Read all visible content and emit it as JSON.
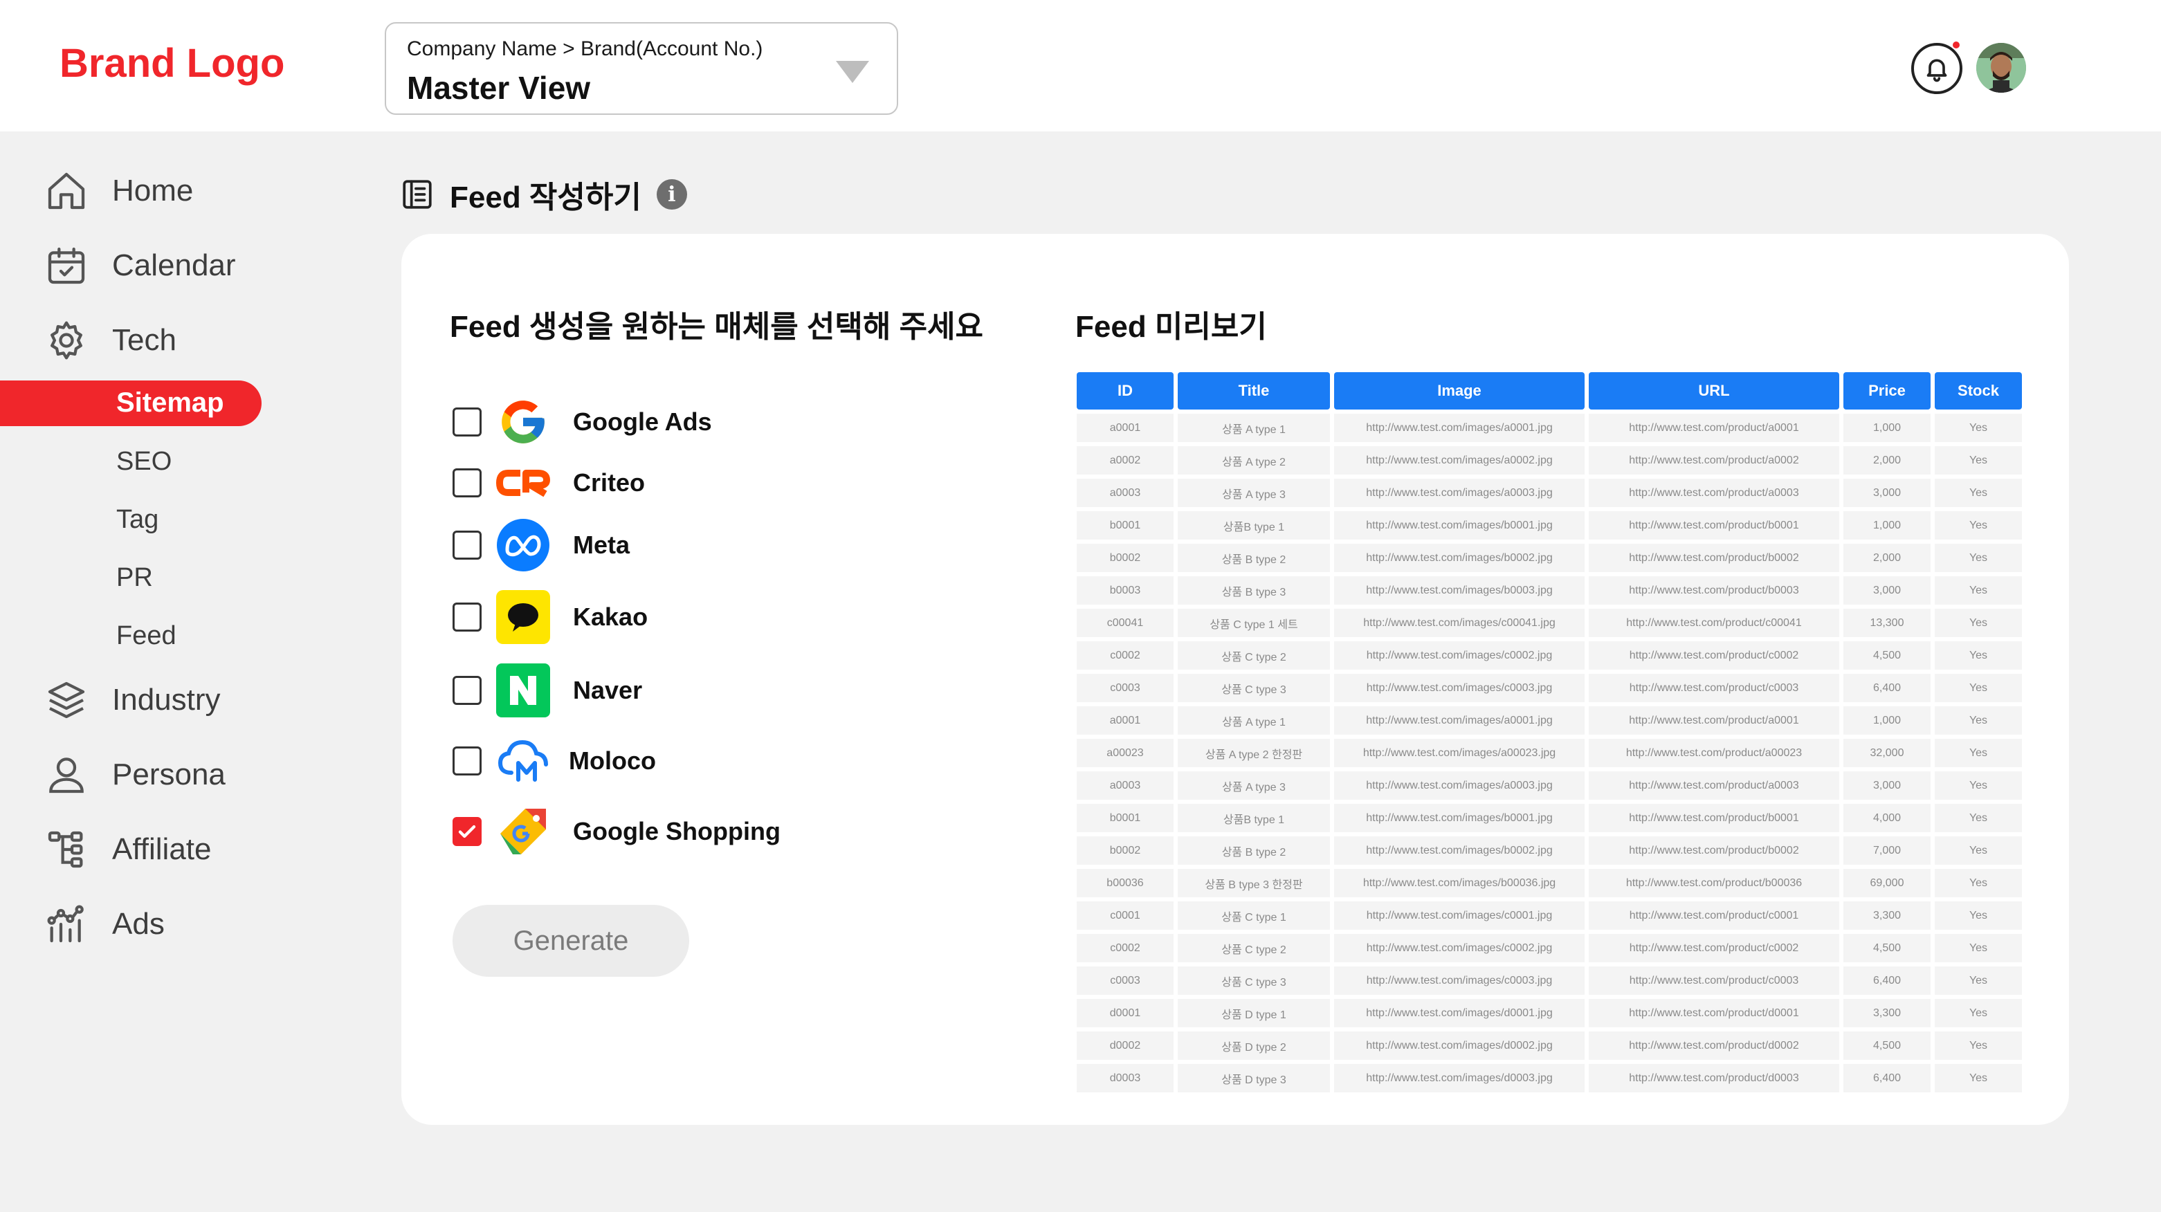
{
  "header": {
    "brand": "Brand Logo",
    "account_path": "Company Name > Brand(Account No.)",
    "account_view": "Master View"
  },
  "sidebar": {
    "items": [
      {
        "label": "Home",
        "icon": "home-icon"
      },
      {
        "label": "Calendar",
        "icon": "calendar-icon"
      },
      {
        "label": "Tech",
        "icon": "gear-icon"
      },
      {
        "label": "Industry",
        "icon": "layers-icon"
      },
      {
        "label": "Persona",
        "icon": "user-icon"
      },
      {
        "label": "Affiliate",
        "icon": "tree-icon"
      },
      {
        "label": "Ads",
        "icon": "ads-chart-icon"
      }
    ],
    "tech_sub": [
      "Sitemap",
      "SEO",
      "Tag",
      "PR",
      "Feed"
    ],
    "active_sub": "Sitemap"
  },
  "page": {
    "title": "Feed 작성하기",
    "info_glyph": "i"
  },
  "media_section": {
    "title": "Feed 생성을 원하는 매체를 선택해 주세요",
    "items": [
      {
        "label": "Google Ads",
        "checked": false,
        "icon": "google-logo-icon"
      },
      {
        "label": "Criteo",
        "checked": false,
        "icon": "criteo-logo-icon"
      },
      {
        "label": "Meta",
        "checked": false,
        "icon": "meta-logo-icon"
      },
      {
        "label": "Kakao",
        "checked": false,
        "icon": "kakao-logo-icon"
      },
      {
        "label": "Naver",
        "checked": false,
        "icon": "naver-logo-icon"
      },
      {
        "label": "Moloco",
        "checked": false,
        "icon": "moloco-logo-icon"
      },
      {
        "label": "Google Shopping",
        "checked": true,
        "icon": "google-shopping-logo-icon"
      }
    ],
    "generate_label": "Generate"
  },
  "preview": {
    "title": "Feed 미리보기",
    "columns": [
      "ID",
      "Title",
      "Image",
      "URL",
      "Price",
      "Stock"
    ],
    "rows": [
      [
        "a0001",
        "상품 A type 1",
        "http://www.test.com/images/a0001.jpg",
        "http://www.test.com/product/a0001",
        "1,000",
        "Yes"
      ],
      [
        "a0002",
        "상품 A type 2",
        "http://www.test.com/images/a0002.jpg",
        "http://www.test.com/product/a0002",
        "2,000",
        "Yes"
      ],
      [
        "a0003",
        "상품 A type 3",
        "http://www.test.com/images/a0003.jpg",
        "http://www.test.com/product/a0003",
        "3,000",
        "Yes"
      ],
      [
        "b0001",
        "상품B type 1",
        "http://www.test.com/images/b0001.jpg",
        "http://www.test.com/product/b0001",
        "1,000",
        "Yes"
      ],
      [
        "b0002",
        "상품 B type 2",
        "http://www.test.com/images/b0002.jpg",
        "http://www.test.com/product/b0002",
        "2,000",
        "Yes"
      ],
      [
        "b0003",
        "상품 B type 3",
        "http://www.test.com/images/b0003.jpg",
        "http://www.test.com/product/b0003",
        "3,000",
        "Yes"
      ],
      [
        "c00041",
        "상품 C type 1 세트",
        "http://www.test.com/images/c00041.jpg",
        "http://www.test.com/product/c00041",
        "13,300",
        "Yes"
      ],
      [
        "c0002",
        "상품 C type 2",
        "http://www.test.com/images/c0002.jpg",
        "http://www.test.com/product/c0002",
        "4,500",
        "Yes"
      ],
      [
        "c0003",
        "상품 C type 3",
        "http://www.test.com/images/c0003.jpg",
        "http://www.test.com/product/c0003",
        "6,400",
        "Yes"
      ],
      [
        "a0001",
        "상품 A type 1",
        "http://www.test.com/images/a0001.jpg",
        "http://www.test.com/product/a0001",
        "1,000",
        "Yes"
      ],
      [
        "a00023",
        "상품 A type 2 한정판",
        "http://www.test.com/images/a00023.jpg",
        "http://www.test.com/product/a00023",
        "32,000",
        "Yes"
      ],
      [
        "a0003",
        "상품 A type 3",
        "http://www.test.com/images/a0003.jpg",
        "http://www.test.com/product/a0003",
        "3,000",
        "Yes"
      ],
      [
        "b0001",
        "상품B type 1",
        "http://www.test.com/images/b0001.jpg",
        "http://www.test.com/product/b0001",
        "4,000",
        "Yes"
      ],
      [
        "b0002",
        "상품 B type 2",
        "http://www.test.com/images/b0002.jpg",
        "http://www.test.com/product/b0002",
        "7,000",
        "Yes"
      ],
      [
        "b00036",
        "상품 B type 3 한정판",
        "http://www.test.com/images/b00036.jpg",
        "http://www.test.com/product/b00036",
        "69,000",
        "Yes"
      ],
      [
        "c0001",
        "상품 C type 1",
        "http://www.test.com/images/c0001.jpg",
        "http://www.test.com/product/c0001",
        "3,300",
        "Yes"
      ],
      [
        "c0002",
        "상품 C type 2",
        "http://www.test.com/images/c0002.jpg",
        "http://www.test.com/product/c0002",
        "4,500",
        "Yes"
      ],
      [
        "c0003",
        "상품 C type 3",
        "http://www.test.com/images/c0003.jpg",
        "http://www.test.com/product/c0003",
        "6,400",
        "Yes"
      ],
      [
        "d0001",
        "상품 D type 1",
        "http://www.test.com/images/d0001.jpg",
        "http://www.test.com/product/d0001",
        "3,300",
        "Yes"
      ],
      [
        "d0002",
        "상품 D type 2",
        "http://www.test.com/images/d0002.jpg",
        "http://www.test.com/product/d0002",
        "4,500",
        "Yes"
      ],
      [
        "d0003",
        "상품 D type 3",
        "http://www.test.com/images/d0003.jpg",
        "http://www.test.com/product/d0003",
        "6,400",
        "Yes"
      ]
    ]
  },
  "colors": {
    "accent": "#f0262b",
    "table_header": "#1a7cf5",
    "background": "#f1f1f1"
  }
}
